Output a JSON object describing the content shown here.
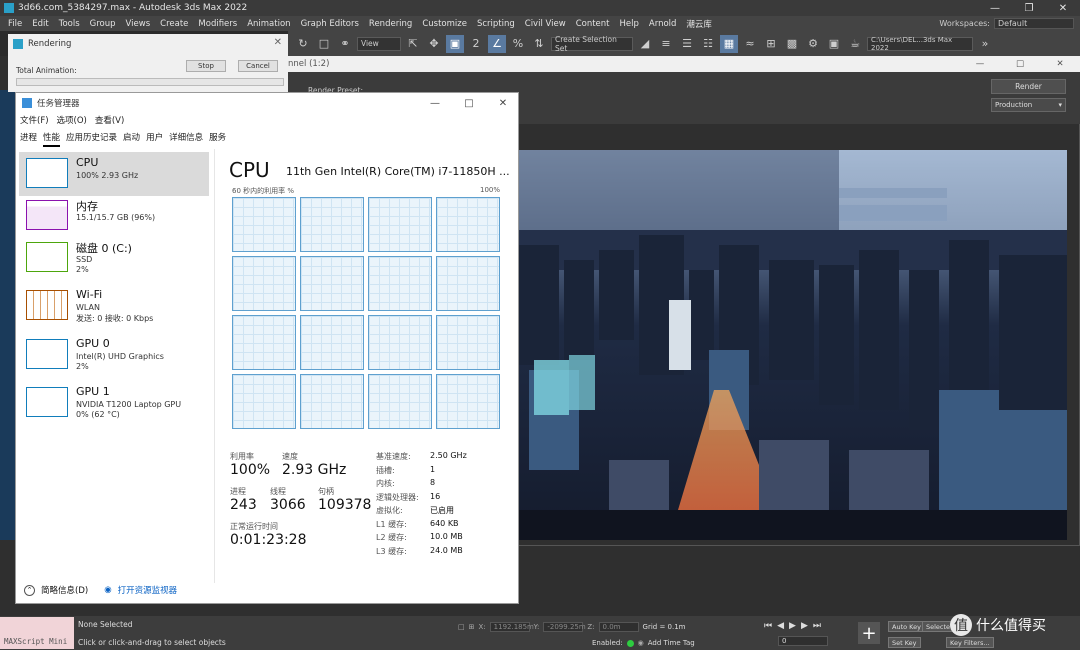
{
  "app": {
    "title": "3d66.com_5384297.max - Autodesk 3ds Max 2022",
    "menu": [
      "File",
      "Edit",
      "Tools",
      "Group",
      "Views",
      "Create",
      "Modifiers",
      "Animation",
      "Graph Editors",
      "Rendering",
      "Customize",
      "Scripting",
      "Civil View",
      "Content",
      "Help",
      "Arnold",
      "潮云库"
    ],
    "workspace_label": "Workspaces:",
    "workspace_value": "Default",
    "view_dropdown": "View",
    "selection_set": "Create Selection Set",
    "path": "C:\\Users\\DEL...3ds Max 2022",
    "toolbar_icons": [
      "undo-icon",
      "select-region-icon",
      "link-icon",
      "view-icon",
      "move-icon",
      "rotate-icon",
      "scale-icon",
      "snap-icon",
      "angle-snap-icon",
      "percent-snap-icon",
      "spinner-snap-icon",
      "mirror-icon",
      "align-icon",
      "layer-icon",
      "ribbon-icon",
      "curve-editor-icon",
      "schematic-icon",
      "material-icon",
      "render-setup-icon",
      "render-frame-icon",
      "render-icon"
    ]
  },
  "render_window": {
    "title": "nnel (1:2)",
    "render_preset_label": "Render Preset:",
    "render_button": "Render",
    "production": "Production"
  },
  "rendering_dialog": {
    "title": "Rendering",
    "stop": "Stop",
    "cancel": "Cancel",
    "total_animation": "Total Animation:"
  },
  "task_manager": {
    "title": "任务管理器",
    "menu": [
      "文件(F)",
      "选项(O)",
      "查看(V)"
    ],
    "tabs": [
      "进程",
      "性能",
      "应用历史记录",
      "启动",
      "用户",
      "详细信息",
      "服务"
    ],
    "active_tab": 1,
    "resources": [
      {
        "name": "CPU",
        "sub1": "100% 2.93 GHz",
        "sub2": "",
        "color": "#117dbb"
      },
      {
        "name": "内存",
        "sub1": "15.1/15.7 GB (96%)",
        "sub2": "",
        "color": "#8b12ae"
      },
      {
        "name": "磁盘 0 (C:)",
        "sub1": "SSD",
        "sub2": "2%",
        "color": "#4da60c"
      },
      {
        "name": "Wi-Fi",
        "sub1": "WLAN",
        "sub2": "发送: 0 接收: 0 Kbps",
        "color": "#a74f01"
      },
      {
        "name": "GPU 0",
        "sub1": "Intel(R) UHD Graphics",
        "sub2": "2%",
        "color": "#117dbb"
      },
      {
        "name": "GPU 1",
        "sub1": "NVIDIA T1200 Laptop GPU",
        "sub2": "0% (62 °C)",
        "color": "#117dbb"
      }
    ],
    "cpu": {
      "heading": "CPU",
      "model": "11th Gen Intel(R) Core(TM) i7-11850H ...",
      "graph_left": "60 秒内的利用率 %",
      "graph_right": "100%",
      "util_label": "利用率",
      "util": "100%",
      "speed_label": "速度",
      "speed": "2.93 GHz",
      "proc_label": "进程",
      "proc": "243",
      "thread_label": "线程",
      "thread": "3066",
      "handle_label": "句柄",
      "handle": "109378",
      "uptime_label": "正常运行时间",
      "uptime": "0:01:23:28",
      "specs": [
        {
          "k": "基准速度:",
          "v": "2.50 GHz"
        },
        {
          "k": "插槽:",
          "v": "1"
        },
        {
          "k": "内核:",
          "v": "8"
        },
        {
          "k": "逻辑处理器:",
          "v": "16"
        },
        {
          "k": "虚拟化:",
          "v": "已启用"
        },
        {
          "k": "L1 缓存:",
          "v": "640 KB"
        },
        {
          "k": "L2 缓存:",
          "v": "10.0 MB"
        },
        {
          "k": "L3 缓存:",
          "v": "24.0 MB"
        }
      ]
    },
    "footer_brief": "简略信息(D)",
    "footer_link": "打开资源监视器"
  },
  "statusbar": {
    "maxscript": "MAXScript Mini",
    "selected": "None Selected",
    "hint": "Click or click-and-drag to select objects",
    "x_label": "X:",
    "x_val": "1192.185m",
    "y_label": "Y:",
    "y_val": "-2099.25m",
    "z_label": "Z:",
    "z_val": "0.0m",
    "grid": "Grid = 0.1m",
    "enabled": "Enabled:",
    "add_time_tag": "Add Time Tag",
    "auto_key": "Auto Key",
    "set_key": "Set Key",
    "selected_btn": "Selecte",
    "key_filters": "Key Filters...",
    "frame": "0"
  },
  "watermark": {
    "logo": "值",
    "text": "什么值得买"
  }
}
